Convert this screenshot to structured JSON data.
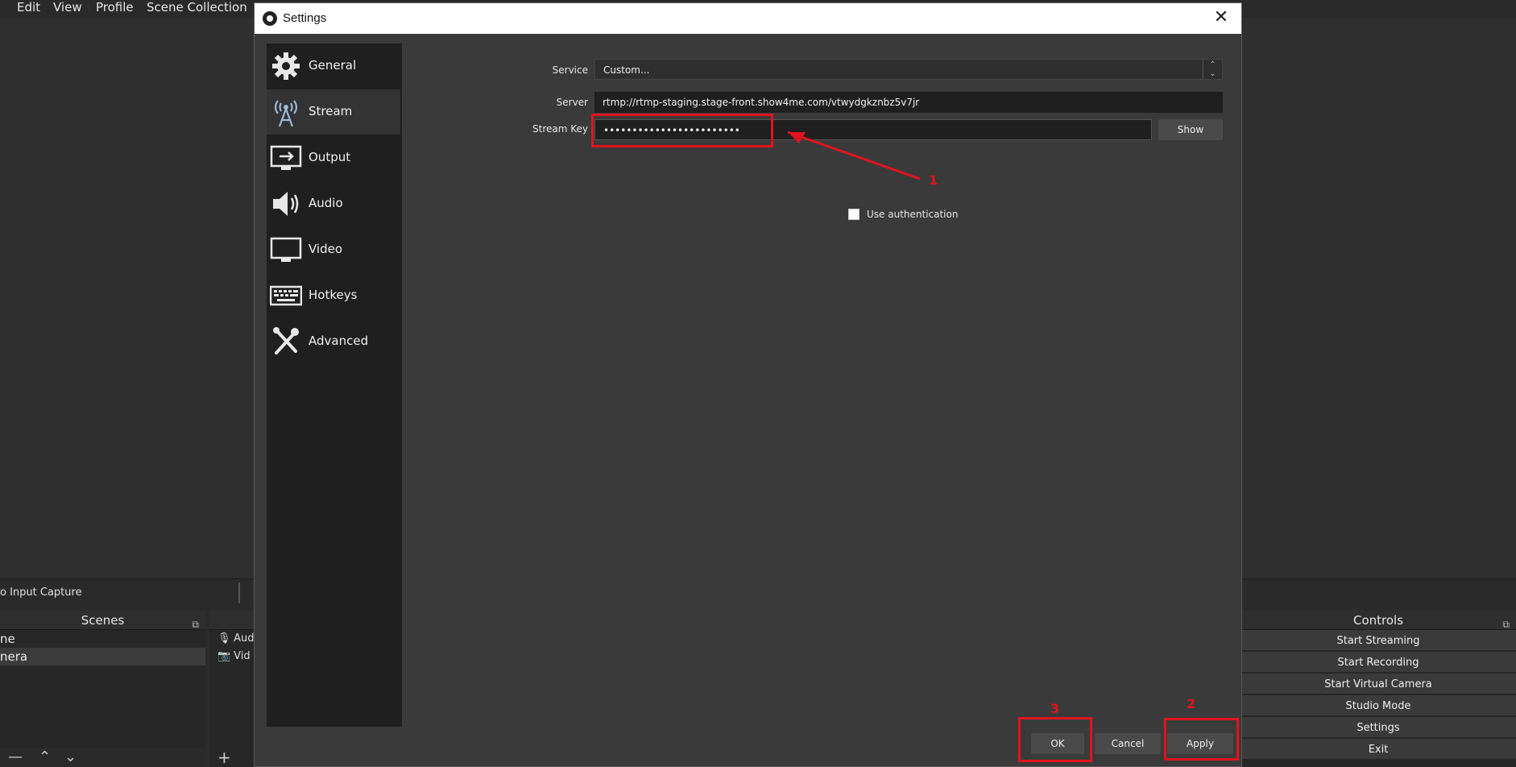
{
  "menubar": {
    "items": [
      "Edit",
      "View",
      "Profile",
      "Scene Collection"
    ]
  },
  "source_strip": {
    "label": "o Input Capture"
  },
  "scenes": {
    "title": "Scenes",
    "items": [
      "ne",
      "nera"
    ]
  },
  "sources": {
    "items": [
      {
        "label": "Aud",
        "icon": "microphone-icon"
      },
      {
        "label": "Vid",
        "icon": "camera-icon"
      }
    ]
  },
  "controls": {
    "title": "Controls",
    "buttons": [
      "Start Streaming",
      "Start Recording",
      "Start Virtual Camera",
      "Studio Mode",
      "Settings",
      "Exit"
    ]
  },
  "dialog": {
    "title": "Settings",
    "close_glyph": "✕",
    "nav": [
      {
        "label": "General",
        "icon": "gear-icon"
      },
      {
        "label": "Stream",
        "icon": "antenna-icon",
        "selected": true
      },
      {
        "label": "Output",
        "icon": "output-monitor-icon"
      },
      {
        "label": "Audio",
        "icon": "speaker-icon"
      },
      {
        "label": "Video",
        "icon": "monitor-icon"
      },
      {
        "label": "Hotkeys",
        "icon": "keyboard-icon"
      },
      {
        "label": "Advanced",
        "icon": "tools-icon"
      }
    ],
    "stream": {
      "service_label": "Service",
      "service_value": "Custom...",
      "server_label": "Server",
      "server_value": "rtmp://rtmp-staging.stage-front.show4me.com/vtwydgkznbz5v7jr",
      "key_label": "Stream Key",
      "key_value": "••••••••••••••••••••••••",
      "show_button": "Show",
      "auth_label": "Use authentication",
      "auth_checked": false
    },
    "buttons": {
      "ok": "OK",
      "cancel": "Cancel",
      "apply": "Apply"
    }
  },
  "annotations": {
    "step1": "1",
    "step2": "2",
    "step3": "3",
    "color": "#e0141e"
  }
}
